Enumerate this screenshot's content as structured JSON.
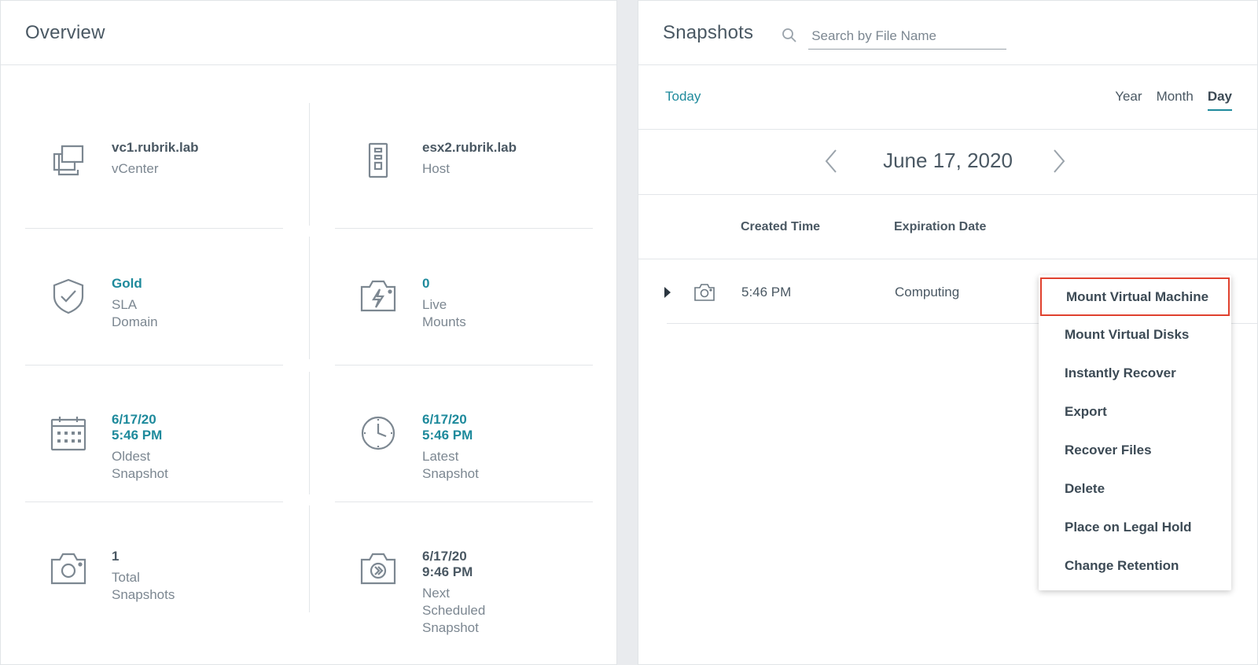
{
  "overview": {
    "title": "Overview",
    "cells": {
      "vcenter": {
        "value": "vc1.rubrik.lab",
        "label": "vCenter",
        "icon": "vcenter-icon"
      },
      "host": {
        "value": "esx2.rubrik.lab",
        "label": "Host",
        "icon": "server-icon"
      },
      "sla": {
        "value": "Gold",
        "label": "SLA Domain",
        "icon": "shield-check-icon"
      },
      "live_mounts": {
        "value": "0",
        "label": "Live Mounts",
        "icon": "live-mount-icon"
      },
      "oldest": {
        "value": "6/17/20 5:46 PM",
        "label": "Oldest Snapshot",
        "icon": "calendar-icon"
      },
      "latest": {
        "value": "6/17/20 5:46 PM",
        "label": "Latest Snapshot",
        "icon": "clock-icon"
      },
      "total": {
        "value": "1",
        "label": "Total Snapshots",
        "icon": "camera-icon"
      },
      "next": {
        "value": "6/17/20 9:46 PM",
        "label": "Next Scheduled Snapshot",
        "icon": "scheduled-camera-icon"
      }
    }
  },
  "snapshots": {
    "title": "Snapshots",
    "search_placeholder": "Search by File Name",
    "today_label": "Today",
    "range_tabs": {
      "year": "Year",
      "month": "Month",
      "day": "Day"
    },
    "active_range": "Day",
    "date": "June 17, 2020",
    "columns": {
      "created": "Created Time",
      "expiration": "Expiration Date"
    },
    "rows": [
      {
        "created": "5:46 PM",
        "expiration": "Computing"
      }
    ]
  },
  "context_menu": {
    "items": [
      "Mount Virtual Machine",
      "Mount Virtual Disks",
      "Instantly Recover",
      "Export",
      "Recover Files",
      "Delete",
      "Place on Legal Hold",
      "Change Retention"
    ],
    "highlighted": "Mount Virtual Machine"
  },
  "colors": {
    "accent": "#1e8a9c",
    "highlight_border": "#e0412e",
    "text": "#3c4a55",
    "muted": "#7c8791"
  }
}
